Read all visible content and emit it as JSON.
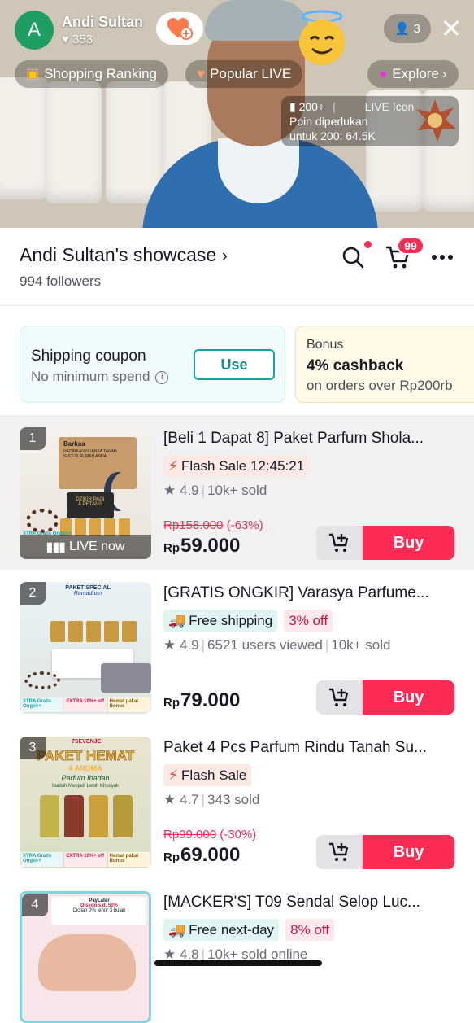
{
  "live": {
    "host_initial": "A",
    "host_name": "Andi Sultan",
    "likes": "353",
    "viewer_count": "3",
    "pills": [
      "Shopping Ranking",
      "Popular LIVE",
      "Explore"
    ],
    "rank_value": "200+",
    "live_icon_label": "LIVE Icon",
    "points_line1": "Poin diperlukan",
    "points_line2": "untuk 200: 64.5K"
  },
  "shop": {
    "title": "Andi Sultan's showcase",
    "followers": "994 followers",
    "cart_count": "99"
  },
  "coupon": {
    "title": "Shipping coupon",
    "subtitle": "No minimum spend",
    "use_label": "Use"
  },
  "bonus": {
    "label": "Bonus",
    "title": "4% cashback",
    "subtitle": "on orders over Rp200rb"
  },
  "products": [
    {
      "rank": "1",
      "title": "[Beli 1 Dapat 8] Paket Parfum Shola...",
      "tags": [
        {
          "type": "flash",
          "text": "Flash Sale 12:45:21"
        }
      ],
      "stats": [
        "4.9",
        "10k+ sold"
      ],
      "original_price": "Rp158.000",
      "discount": "(-63%)",
      "price_rp": "Rp",
      "price": "59.000",
      "live_label": "LIVE now",
      "buy_label": "Buy",
      "image_text": [
        "Barkaa",
        "HADIRKAN NUANSA TANAH",
        "SUCI DI RUMAH ANDA",
        "DZIKIR PAGI",
        "& PETANG",
        "XTRA",
        "Gratis Ongkir+"
      ]
    },
    {
      "rank": "2",
      "title": "[GRATIS ONGKIR] Varasya Parfume...",
      "tags": [
        {
          "type": "ship",
          "text": "Free shipping"
        },
        {
          "type": "off",
          "text": "3% off"
        }
      ],
      "stats": [
        "4.9",
        "6521 users viewed",
        "10k+ sold"
      ],
      "price_rp": "Rp",
      "price": "79.000",
      "buy_label": "Buy",
      "image_text": [
        "PAKET SPECIAL",
        "Ramadhan",
        "XTRA",
        "Gratis Ongkir+",
        "EXTRA",
        "10%+ off",
        "Hemat pakai",
        "Bonus"
      ]
    },
    {
      "rank": "3",
      "title": "Paket 4 Pcs Parfum Rindu Tanah Su...",
      "tags": [
        {
          "type": "flash",
          "text": "Flash Sale"
        }
      ],
      "stats": [
        "4.7",
        "343 sold"
      ],
      "original_price": "Rp99.000",
      "discount": "(-30%)",
      "price_rp": "Rp",
      "price": "69.000",
      "buy_label": "Buy",
      "image_text": [
        "7SEVENJE",
        "PAKET HEMAT",
        "4 AROMA",
        "Parfum Ibadah",
        "Ibadah Menjadi Lebih Khusyuk",
        "XTRA",
        "Gratis Ongkir+",
        "EXTRA",
        "10%+ off",
        "Hemat pakai",
        "Bonus"
      ]
    },
    {
      "rank": "4",
      "title": "[MACKER'S] T09 Sendal Selop Luc...",
      "tags": [
        {
          "type": "ship",
          "text": "Free next-day"
        },
        {
          "type": "off",
          "text": "8% off"
        }
      ],
      "stats": [
        "4.8",
        "10k+ sold online"
      ],
      "image_text": [
        "PayLater",
        "Diskon s.d. 50%",
        "Cicilan 0% tenor 3 bulan"
      ]
    }
  ],
  "colors": {
    "accent": "#fe2c55",
    "teal": "#13a3a8"
  },
  "icons": [
    "heart-icon",
    "add-friend-icon",
    "bag-icon",
    "flame-icon",
    "planet-icon",
    "close-icon",
    "person-icon",
    "search-icon",
    "cart-icon",
    "more-icon",
    "info-icon",
    "bolt-icon",
    "truck-icon",
    "star-icon",
    "add-to-cart-icon",
    "live-bars-icon"
  ]
}
